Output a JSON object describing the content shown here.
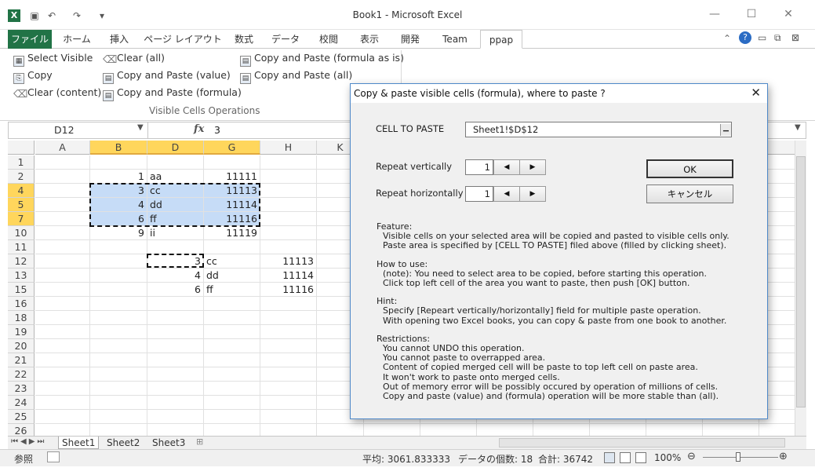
{
  "window": {
    "title": "Book1 - Microsoft Excel",
    "buttons": [
      "—",
      "☐",
      "✕"
    ]
  },
  "qat": {
    "icons": [
      "excel-logo-icon",
      "save-icon",
      "undo-icon",
      "redo-icon",
      "customize-icon"
    ]
  },
  "tabs": [
    "ファイル",
    "ホーム",
    "挿入",
    "ページ レイアウト",
    "数式",
    "データ",
    "校閲",
    "表示",
    "開発",
    "Team",
    "ppap"
  ],
  "ribbon": {
    "buttons": [
      {
        "label": "Select Visible"
      },
      {
        "label": "Copy"
      },
      {
        "label": "Clear (content)"
      },
      {
        "label": "Clear (all)"
      },
      {
        "label": "Copy and Paste (value)"
      },
      {
        "label": "Copy and Paste (formula)"
      },
      {
        "label": "Copy and Paste (formula as is)"
      },
      {
        "label": "Copy and Paste (all)"
      }
    ],
    "group_label": "Visible Cells Operations"
  },
  "formula_bar": {
    "name_box": "D12",
    "fx": "fx",
    "value": "3"
  },
  "grid": {
    "columns": [
      "A",
      "B",
      "D",
      "G",
      "H",
      "K"
    ],
    "selected_columns": [
      "B",
      "D",
      "G"
    ],
    "rows": [
      "1",
      "2",
      "4",
      "5",
      "7",
      "10",
      "11",
      "12",
      "13",
      "15",
      "16",
      "18",
      "19",
      "20",
      "21",
      "22",
      "23",
      "24",
      "25",
      "26"
    ],
    "selected_rows": [
      "4",
      "5",
      "7"
    ],
    "cells": [
      {
        "row": "2",
        "col": "B",
        "value": "1"
      },
      {
        "row": "2",
        "col": "D",
        "value": "aa"
      },
      {
        "row": "2",
        "col": "G",
        "value": "11111"
      },
      {
        "row": "4",
        "col": "B",
        "value": "3"
      },
      {
        "row": "4",
        "col": "D",
        "value": "cc"
      },
      {
        "row": "4",
        "col": "G",
        "value": "11113"
      },
      {
        "row": "5",
        "col": "B",
        "value": "4"
      },
      {
        "row": "5",
        "col": "D",
        "value": "dd"
      },
      {
        "row": "5",
        "col": "G",
        "value": "11114"
      },
      {
        "row": "7",
        "col": "B",
        "value": "6"
      },
      {
        "row": "7",
        "col": "D",
        "value": "ff"
      },
      {
        "row": "7",
        "col": "G",
        "value": "11116"
      },
      {
        "row": "10",
        "col": "B",
        "value": "9"
      },
      {
        "row": "10",
        "col": "D",
        "value": "ii"
      },
      {
        "row": "10",
        "col": "G",
        "value": "11119"
      },
      {
        "row": "12",
        "col": "D",
        "value": "3"
      },
      {
        "row": "12",
        "col": "G",
        "value": "cc"
      },
      {
        "row": "12",
        "col": "H",
        "value": "11113"
      },
      {
        "row": "13",
        "col": "D",
        "value": "4"
      },
      {
        "row": "13",
        "col": "G",
        "value": "dd"
      },
      {
        "row": "13",
        "col": "H",
        "value": "11114"
      },
      {
        "row": "15",
        "col": "D",
        "value": "6"
      },
      {
        "row": "15",
        "col": "G",
        "value": "ff"
      },
      {
        "row": "15",
        "col": "H",
        "value": "11116"
      }
    ]
  },
  "sheets": [
    "Sheet1",
    "Sheet2",
    "Sheet3"
  ],
  "status": {
    "mode": "参照",
    "average": "平均: 3061.833333",
    "count": "データの個数: 18",
    "sum": "合計: 36742",
    "zoom": "100%"
  },
  "dialog": {
    "title": "Copy & paste visible cells (formula), where to paste ?",
    "cell_to_paste_label": "CELL TO PASTE",
    "cell_to_paste_value": "Sheet1!$D$12",
    "repeat_v_label": "Repeat vertically",
    "repeat_v_value": "1",
    "repeat_h_label": "Repeat horizontally",
    "repeat_h_value": "1",
    "ok": "OK",
    "cancel": "キャンセル",
    "sections": [
      {
        "heading": "Feature:",
        "lines": [
          "Visible cells on your selected area will be copied and pasted to visible cells only.",
          "Paste area is specified by [CELL TO PASTE] filed above (filled by clicking sheet)."
        ]
      },
      {
        "heading": "How to use:",
        "lines": [
          "(note): You need to select area to be copied, before starting this operation.",
          "Click top left cell of the area you want to paste, then push [OK] button."
        ]
      },
      {
        "heading": "Hint:",
        "lines": [
          "Specify [Repeart vertically/horizontally] field for multiple paste operation.",
          "With opening two Excel books, you can copy & paste from one book to another."
        ]
      },
      {
        "heading": "Restrictions:",
        "lines": [
          "You cannot UNDO this operation.",
          "You cannot paste to overrapped area.",
          "Content of copied merged cell will be paste to top left cell on paste area.",
          "It won't work to paste onto merged cells.",
          "Out of memory error will be possibly occured by operation of millions of cells.",
          "Copy and paste (value) and (formula) operation will be more stable than (all)."
        ]
      }
    ]
  }
}
